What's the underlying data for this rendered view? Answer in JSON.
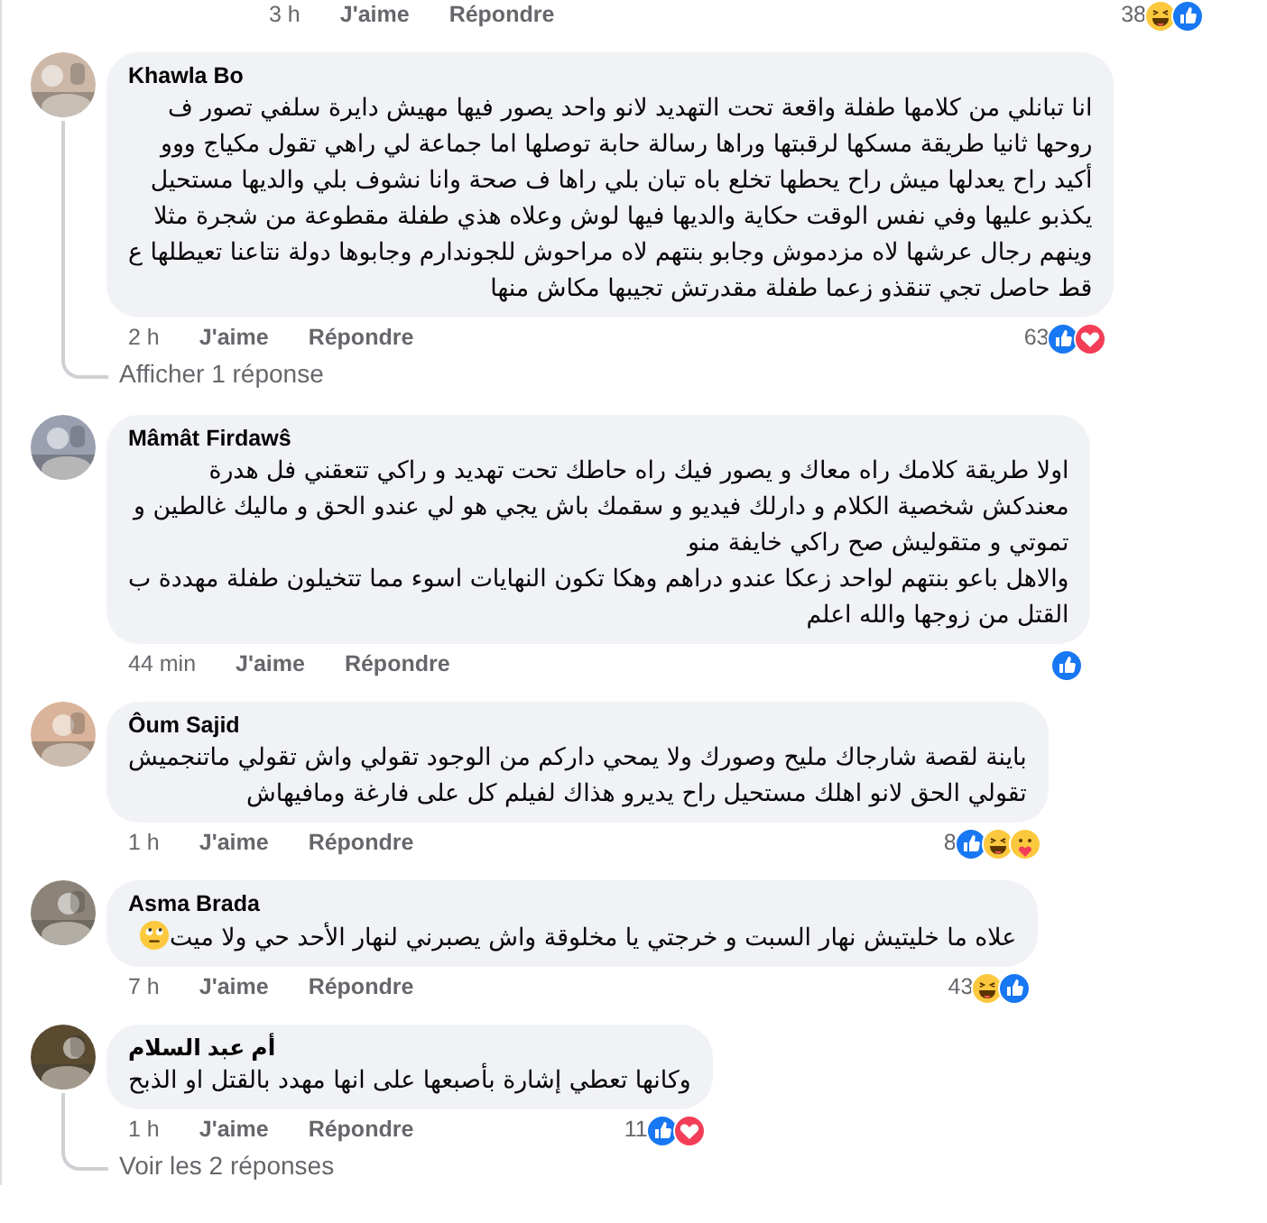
{
  "previous_comment_footer": {
    "time": "3 h",
    "like": "J'aime",
    "reply": "Répondre",
    "count": "38",
    "reactions": [
      {
        "kind": "haha"
      },
      {
        "kind": "like"
      }
    ]
  },
  "comments": [
    {
      "author": "Khawla Bo",
      "lines": [
        "انا تبانلي من كلامها طفلة واقعة تحت التهديد لانو واحد يصور فيها مهيش دايرة سلفي تصور ف",
        "روحها ثانيا طريقة مسكها لرقبتها وراها رسالة حابة توصلها اما جماعة لي راهي تقول مكياج ووو",
        "أكيد راح يعدلها ميش راح يحطها تخلع باه تبان بلي راها ف صحة وانا نشوف بلي والديها مستحيل",
        "يكذبو عليها وفي نفس الوقت حكاية والديها فيها لوش وعلاه هذي طفلة مقطوعة من شجرة مثلا",
        "وينهم رجال عرشها لاه مزدموش وجابو بنتهم لاه مراحوش للجوندارم وجابوها دولة نتاعنا تعيطلها ع",
        "قط حاصل تجي تنقذو زعما طفلة مقدرتش تجيبها مكاش منها"
      ],
      "time": "2 h",
      "like": "J'aime",
      "reply": "Répondre",
      "count": "63",
      "reactions": [
        {
          "kind": "like"
        },
        {
          "kind": "love"
        }
      ],
      "replies_link": "Afficher 1 réponse"
    },
    {
      "author": "Mâmât Firdawŝ",
      "lines": [
        "اولا طريقة كلامك راه معاك و يصور فيك راه حاطك تحت تهديد و راكي تتعقني فل هدرة",
        "معندكش شخصية الكلام و دارلك فيديو و سقمك باش يجي هو لي عندو الحق و ماليك غالطين و",
        "تموتي و متقوليش صح راكي خايفة منو",
        "والاهل باعو بنتهم لواحد زعكا عندو دراهم وهكا تكون النهايات اسوء مما تتخيلون طفلة مهددة ب",
        "القتل من زوجها والله اعلم"
      ],
      "time": "44 min",
      "like": "J'aime",
      "reply": "Répondre",
      "reactions": [
        {
          "kind": "like"
        }
      ]
    },
    {
      "author": "Ôum Sajid",
      "lines": [
        "باينة لقصة شارجاك مليح وصورك ولا يمحي داركم من الوجود تقولي واش تقولي ماتنجميش",
        "تقولي الحق لانو اهلك مستحيل راح يديرو هذاك لفيلم كل على فارغة ومافيهاش"
      ],
      "time": "1 h",
      "like": "J'aime",
      "reply": "Répondre",
      "count": "8",
      "reactions": [
        {
          "kind": "like"
        },
        {
          "kind": "haha"
        },
        {
          "kind": "care"
        }
      ]
    },
    {
      "author": "Asma Brada",
      "lines": [
        "علاه ما خليتيش نهار السبت و خرجتي يا مخلوقة واش يصبرني لنهار الأحد حي ولا ميت"
      ],
      "emoji": {
        "kind": "rolling-eyes"
      },
      "time": "7 h",
      "like": "J'aime",
      "reply": "Répondre",
      "count": "43",
      "reactions": [
        {
          "kind": "haha"
        },
        {
          "kind": "like"
        }
      ]
    },
    {
      "author": "أم عبد السلام",
      "lines": [
        "وكانها تعطي إشارة بأصبعها على انها مهدد بالقتل او الذبح"
      ],
      "time": "1 h",
      "like": "J'aime",
      "reply": "Répondre",
      "count": "11",
      "reactions": [
        {
          "kind": "like"
        },
        {
          "kind": "love"
        }
      ],
      "replies_link": "Voir les 2 réponses"
    }
  ]
}
